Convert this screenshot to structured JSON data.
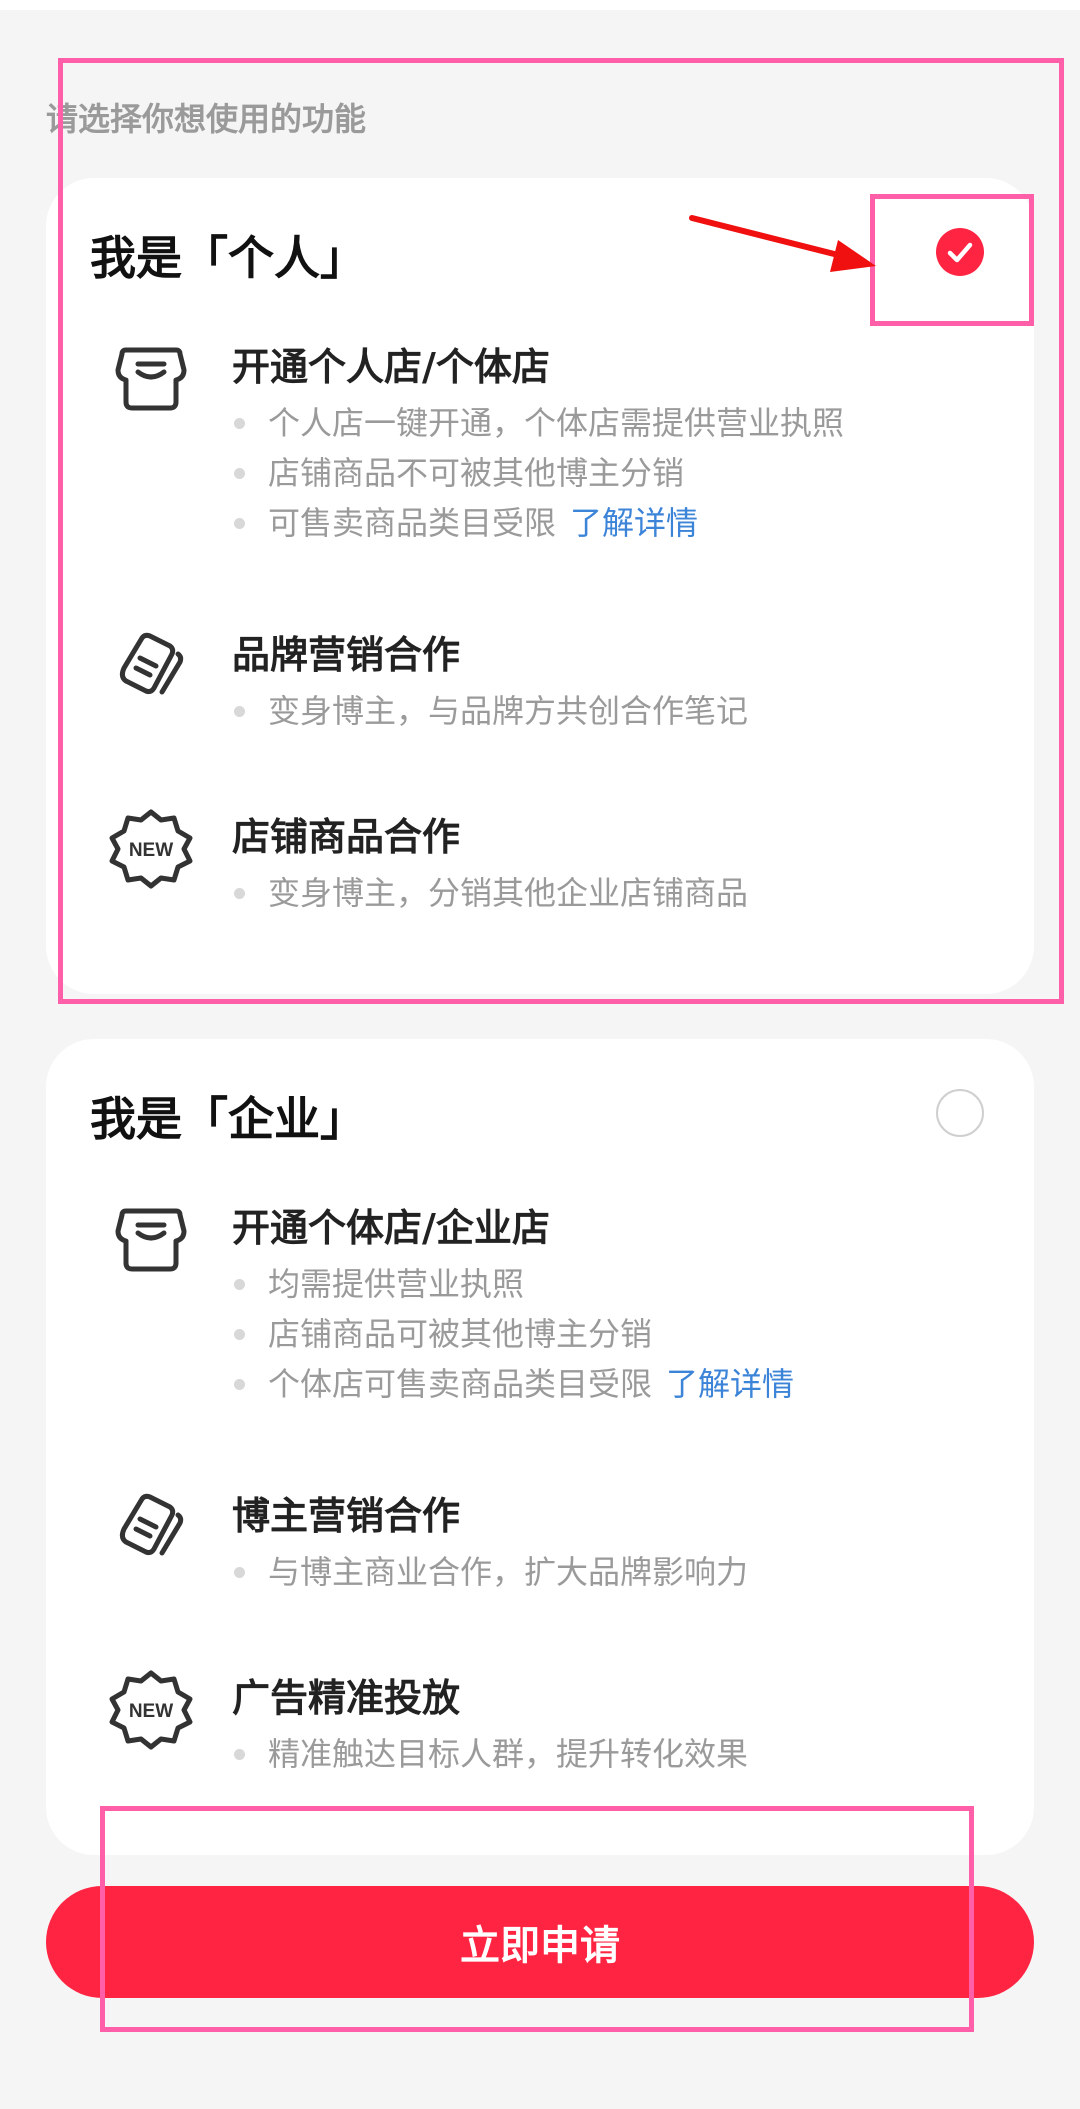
{
  "prompt": "请选择你想使用的功能",
  "personal": {
    "title": "我是「个人」",
    "selected": true,
    "features": [
      {
        "icon": "store-icon",
        "title": "开通个人店/个体店",
        "bullets": [
          "个人店一键开通，个体店需提供营业执照",
          "店铺商品不可被其他博主分销",
          "可售卖商品类目受限"
        ],
        "link": "了解详情"
      },
      {
        "icon": "note-icon",
        "title": "品牌营销合作",
        "bullets": [
          "变身博主，与品牌方共创合作笔记"
        ]
      },
      {
        "icon": "new-badge-icon",
        "title": "店铺商品合作",
        "bullets": [
          "变身博主，分销其他企业店铺商品"
        ]
      }
    ]
  },
  "company": {
    "title": "我是「企业」",
    "selected": false,
    "features": [
      {
        "icon": "store-icon",
        "title": "开通个体店/企业店",
        "bullets": [
          "均需提供营业执照",
          "店铺商品可被其他博主分销",
          "个体店可售卖商品类目受限"
        ],
        "link": "了解详情"
      },
      {
        "icon": "note-icon",
        "title": "博主营销合作",
        "bullets": [
          "与博主商业合作，扩大品牌影响力"
        ]
      },
      {
        "icon": "new-badge-icon",
        "title": "广告精准投放",
        "bullets": [
          "精准触达目标人群，提升转化效果"
        ]
      }
    ]
  },
  "apply_button": "立即申请",
  "colors": {
    "accent": "#ff2442",
    "link": "#3c84d8",
    "highlight": "#ff5fa8",
    "arrow": "#f01010"
  }
}
